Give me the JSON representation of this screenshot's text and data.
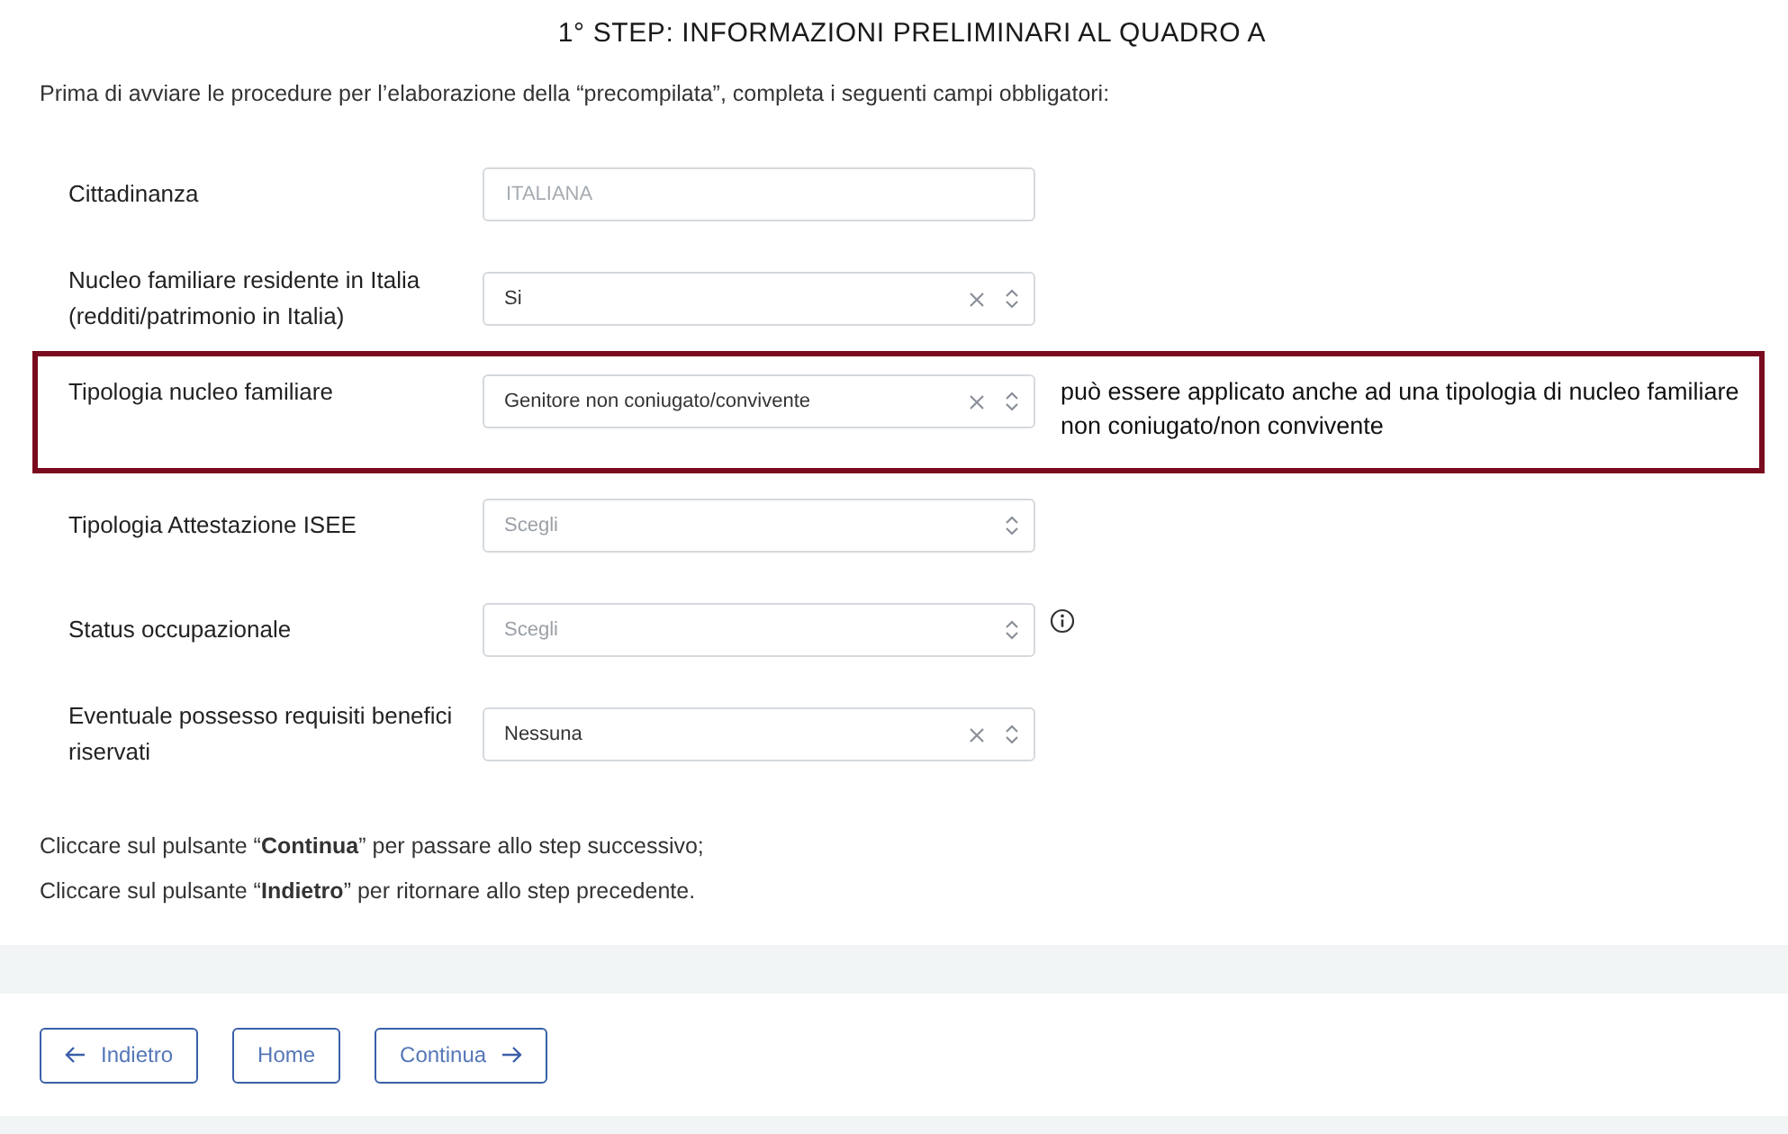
{
  "title": "1° STEP: INFORMAZIONI PRELIMINARI AL QUADRO A",
  "intro": "Prima di avviare le procedure per l’elaborazione della “precompilata”, completa i seguenti campi obbligatori:",
  "fields": [
    {
      "label": "Cittadinanza",
      "kind": "input",
      "value": "ITALIANA",
      "disabled": true
    },
    {
      "label": "Nucleo familiare residente in Italia (redditi/patrimonio in Italia)",
      "kind": "select",
      "value": "Si",
      "clearable": true
    },
    {
      "label": "Tipologia nucleo familiare",
      "kind": "select",
      "value": "Genitore non coniugato/convivente",
      "clearable": true,
      "note": "può essere applicato anche ad una tipologia di nucleo familiare non coniugato/non convivente"
    },
    {
      "label": "Tipologia Attestazione ISEE",
      "kind": "select",
      "placeholder": "Scegli",
      "clearable": false
    },
    {
      "label": "Status occupazionale",
      "kind": "select",
      "placeholder": "Scegli",
      "clearable": false,
      "info": true
    },
    {
      "label": "Eventuale possesso requisiti benefici riservati",
      "kind": "select",
      "value": "Nessuna",
      "clearable": true
    }
  ],
  "instructions": [
    "Cliccare sul pulsante “**Continua**” per passare allo step successivo;",
    "Cliccare sul pulsante “**Indietro**” per ritornare allo step precedente."
  ],
  "buttons": [
    {
      "label": "Indietro",
      "kind": "back"
    },
    {
      "label": "Home",
      "kind": "plain"
    },
    {
      "label": "Continua",
      "kind": "forward"
    }
  ]
}
